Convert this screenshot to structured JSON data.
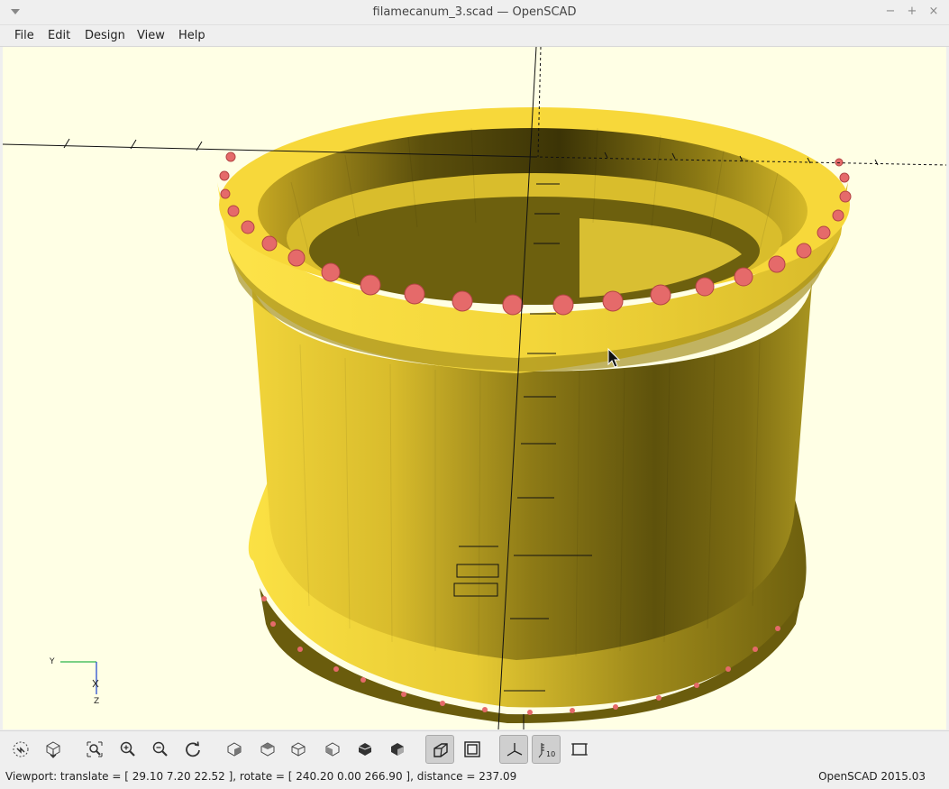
{
  "window": {
    "title": "filamecanum_3.scad — OpenSCAD",
    "minimize": "−",
    "maximize": "+",
    "close": "×"
  },
  "menu": {
    "items": [
      "File",
      "Edit",
      "Design",
      "View",
      "Help"
    ]
  },
  "viewport": {
    "background_color": "#ffffe5",
    "model_color": "#f5d11e",
    "highlight_color": "#e56a6a",
    "axes_widget": {
      "y_label": "Y",
      "z_label": "Z"
    }
  },
  "toolbar": {
    "buttons": [
      {
        "name": "preview",
        "icon": "preview-icon"
      },
      {
        "name": "render",
        "icon": "render-icon"
      },
      {
        "name": "view-all",
        "icon": "zoom-all-icon"
      },
      {
        "name": "zoom-in",
        "icon": "zoom-in-icon"
      },
      {
        "name": "zoom-out",
        "icon": "zoom-out-icon"
      },
      {
        "name": "reset-view",
        "icon": "reset-view-icon"
      },
      {
        "name": "view-right",
        "icon": "view-right-icon"
      },
      {
        "name": "view-top",
        "icon": "view-top-icon"
      },
      {
        "name": "view-bottom",
        "icon": "view-bottom-icon"
      },
      {
        "name": "view-left",
        "icon": "view-left-icon"
      },
      {
        "name": "view-front",
        "icon": "view-front-icon"
      },
      {
        "name": "view-back",
        "icon": "view-back-icon"
      },
      {
        "name": "perspective",
        "icon": "perspective-icon",
        "active": true
      },
      {
        "name": "orthogonal",
        "icon": "orthogonal-icon"
      },
      {
        "name": "show-axes",
        "icon": "axes-icon",
        "active": true
      },
      {
        "name": "show-scale-markers",
        "icon": "scale-markers-icon",
        "active": true,
        "label": "10"
      },
      {
        "name": "show-edges",
        "icon": "edges-icon"
      }
    ]
  },
  "status": {
    "viewport_text": "Viewport: translate = [ 29.10 7.20 22.52 ], rotate = [ 240.20 0.00 266.90 ], distance = 237.09",
    "version": "OpenSCAD 2015.03"
  }
}
